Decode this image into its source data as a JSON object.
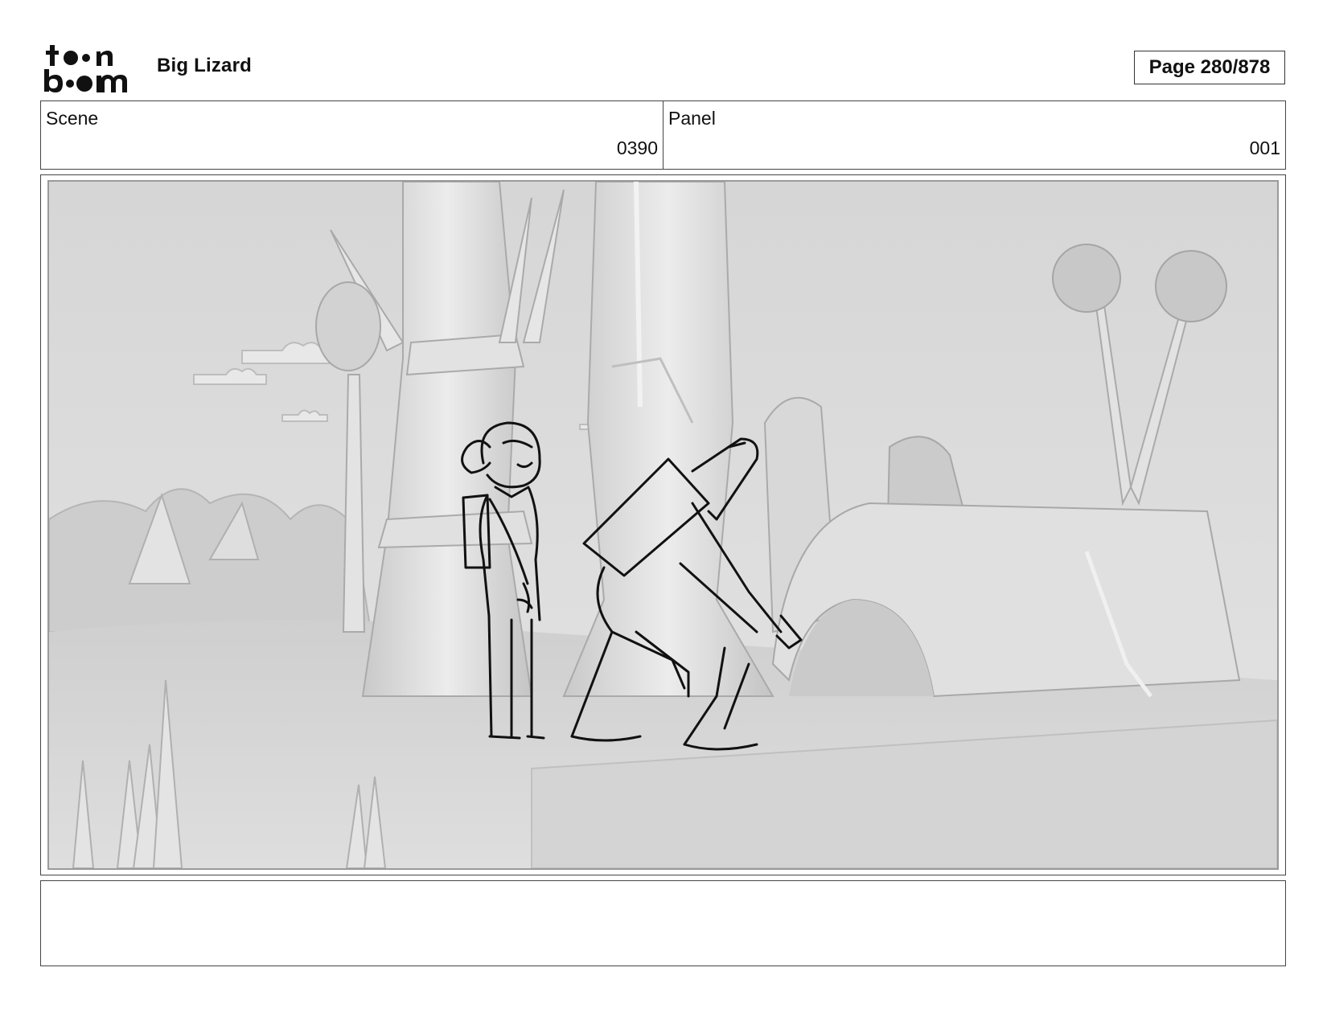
{
  "header": {
    "logo_text": "toon boom",
    "project_title": "Big Lizard",
    "page_label": "Page 280/878"
  },
  "info": {
    "scene_label": "Scene",
    "scene_value": "0390",
    "panel_label": "Panel",
    "panel_value": "001"
  },
  "caption": {
    "text": ""
  },
  "colors": {
    "border": "#444444",
    "panel_background": "#dcdcdc",
    "sketch_line": "#111111"
  }
}
